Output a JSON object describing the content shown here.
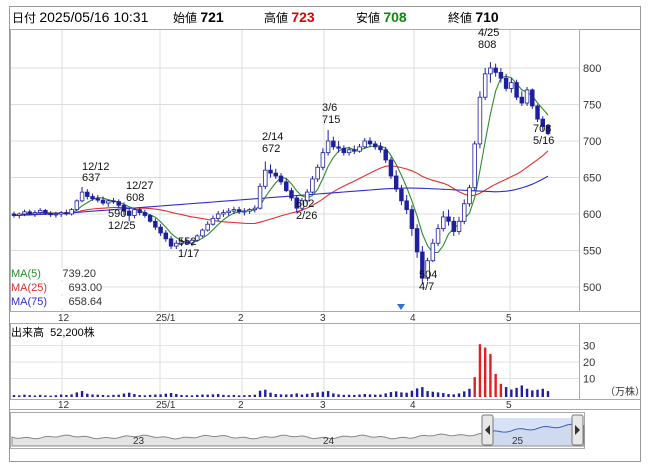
{
  "header": {
    "date_label": "日付",
    "datetime": "2025/05/16 10:31",
    "open_label": "始値",
    "open_value": "721",
    "high_label": "高値",
    "high_value": "723",
    "low_label": "安値",
    "low_value": "708",
    "close_label": "終値",
    "close_value": "710",
    "colors": {
      "high": "#e00000",
      "low": "#0a8a0a",
      "text": "#000000"
    }
  },
  "ma_legend": [
    {
      "label": "MA(5)",
      "value": "739.20",
      "color": "#2e8b2e"
    },
    {
      "label": "MA(25)",
      "value": "693.00",
      "color": "#e03030"
    },
    {
      "label": "MA(75)",
      "value": "658.64",
      "color": "#2f2fd0"
    }
  ],
  "volume": {
    "title": "出来高",
    "value": "52,200株",
    "unit": "（万株）",
    "axis_ticks": [
      "30",
      "20",
      "10"
    ]
  },
  "price_axis_ticks": [
    "800",
    "750",
    "700",
    "650",
    "600",
    "550",
    "500"
  ],
  "month_labels": [
    "12",
    "25/1",
    "2",
    "3",
    "4",
    "5"
  ],
  "navigator": {
    "year_labels": [
      "23",
      "24",
      "25"
    ],
    "left_handle_icon": "chevron-left-icon",
    "right_handle_icon": "chevron-right-icon"
  },
  "annotations": [
    {
      "top": "12/12",
      "bottom": "637"
    },
    {
      "top": "12/27",
      "bottom": "608"
    },
    {
      "top": "590",
      "bottom": "12/25"
    },
    {
      "top": "552",
      "bottom": "1/17"
    },
    {
      "top": "2/14",
      "bottom": "672"
    },
    {
      "top": "602",
      "bottom": "2/26"
    },
    {
      "top": "3/6",
      "bottom": "715"
    },
    {
      "top": "504",
      "bottom": "4/7"
    },
    {
      "top": "4/25",
      "bottom": "808"
    },
    {
      "top": "708",
      "bottom": "5/16"
    }
  ],
  "chart_data": {
    "type": "candlestick",
    "price_range": [
      480,
      830
    ],
    "volume_range": [
      0,
      40
    ],
    "up_color": "#1e1ea0",
    "down_color": "#1e1ea0",
    "series": [
      {
        "name": "MA(5)",
        "color": "#2e8b2e"
      },
      {
        "name": "MA(25)",
        "color": "#e03030"
      },
      {
        "name": "MA(75)",
        "color": "#2f2fd0"
      }
    ],
    "candles": [
      [
        600,
        603,
        595,
        598
      ],
      [
        598,
        602,
        594,
        600
      ],
      [
        600,
        606,
        597,
        603
      ],
      [
        603,
        606,
        598,
        600
      ],
      [
        600,
        605,
        596,
        602
      ],
      [
        602,
        608,
        600,
        605
      ],
      [
        605,
        607,
        599,
        601
      ],
      [
        601,
        604,
        596,
        599
      ],
      [
        599,
        603,
        595,
        600
      ],
      [
        600,
        604,
        596,
        602
      ],
      [
        602,
        606,
        598,
        600
      ],
      [
        600,
        608,
        598,
        606
      ],
      [
        606,
        620,
        604,
        618
      ],
      [
        618,
        637,
        616,
        630
      ],
      [
        630,
        634,
        620,
        624
      ],
      [
        624,
        628,
        618,
        621
      ],
      [
        621,
        626,
        616,
        619
      ],
      [
        619,
        624,
        612,
        615
      ],
      [
        615,
        620,
        610,
        618
      ],
      [
        618,
        622,
        614,
        617
      ],
      [
        617,
        620,
        608,
        612
      ],
      [
        612,
        616,
        598,
        604
      ],
      [
        604,
        608,
        590,
        598
      ],
      [
        598,
        608,
        594,
        606
      ],
      [
        606,
        608,
        598,
        602
      ],
      [
        602,
        606,
        595,
        598
      ],
      [
        598,
        600,
        588,
        590
      ],
      [
        590,
        594,
        578,
        582
      ],
      [
        582,
        586,
        570,
        574
      ],
      [
        574,
        578,
        562,
        566
      ],
      [
        566,
        570,
        552,
        556
      ],
      [
        556,
        564,
        552,
        560
      ],
      [
        560,
        566,
        556,
        562
      ],
      [
        562,
        566,
        558,
        560
      ],
      [
        560,
        566,
        556,
        564
      ],
      [
        564,
        572,
        562,
        570
      ],
      [
        570,
        580,
        568,
        578
      ],
      [
        578,
        590,
        576,
        586
      ],
      [
        586,
        598,
        584,
        594
      ],
      [
        594,
        604,
        590,
        600
      ],
      [
        600,
        606,
        596,
        602
      ],
      [
        602,
        608,
        598,
        604
      ],
      [
        604,
        610,
        600,
        606
      ],
      [
        606,
        610,
        600,
        603
      ],
      [
        603,
        608,
        598,
        604
      ],
      [
        604,
        608,
        600,
        606
      ],
      [
        606,
        612,
        602,
        608
      ],
      [
        608,
        642,
        606,
        638
      ],
      [
        638,
        672,
        634,
        660
      ],
      [
        660,
        668,
        650,
        656
      ],
      [
        656,
        662,
        648,
        652
      ],
      [
        652,
        656,
        640,
        644
      ],
      [
        644,
        648,
        630,
        632
      ],
      [
        632,
        636,
        618,
        622
      ],
      [
        622,
        626,
        602,
        608
      ],
      [
        608,
        622,
        604,
        618
      ],
      [
        618,
        634,
        614,
        630
      ],
      [
        630,
        652,
        628,
        648
      ],
      [
        648,
        668,
        644,
        664
      ],
      [
        664,
        690,
        660,
        684
      ],
      [
        684,
        715,
        680,
        700
      ],
      [
        700,
        706,
        688,
        692
      ],
      [
        692,
        700,
        684,
        690
      ],
      [
        690,
        694,
        680,
        684
      ],
      [
        684,
        692,
        680,
        688
      ],
      [
        688,
        694,
        682,
        686
      ],
      [
        686,
        696,
        684,
        692
      ],
      [
        692,
        704,
        690,
        700
      ],
      [
        700,
        705,
        692,
        696
      ],
      [
        696,
        700,
        688,
        692
      ],
      [
        692,
        698,
        684,
        688
      ],
      [
        688,
        692,
        670,
        674
      ],
      [
        674,
        678,
        648,
        652
      ],
      [
        652,
        660,
        630,
        634
      ],
      [
        634,
        640,
        612,
        618
      ],
      [
        618,
        626,
        600,
        606
      ],
      [
        606,
        612,
        570,
        580
      ],
      [
        580,
        586,
        540,
        548
      ],
      [
        548,
        556,
        504,
        512
      ],
      [
        512,
        540,
        508,
        536
      ],
      [
        536,
        566,
        534,
        560
      ],
      [
        560,
        586,
        556,
        580
      ],
      [
        580,
        604,
        576,
        596
      ],
      [
        596,
        606,
        584,
        590
      ],
      [
        590,
        596,
        570,
        576
      ],
      [
        576,
        596,
        572,
        590
      ],
      [
        590,
        620,
        586,
        614
      ],
      [
        614,
        640,
        610,
        636
      ],
      [
        636,
        700,
        632,
        696
      ],
      [
        696,
        768,
        690,
        760
      ],
      [
        760,
        800,
        756,
        792
      ],
      [
        792,
        808,
        780,
        800
      ],
      [
        800,
        806,
        788,
        794
      ],
      [
        794,
        800,
        780,
        786
      ],
      [
        786,
        792,
        768,
        772
      ],
      [
        772,
        786,
        766,
        780
      ],
      [
        780,
        784,
        756,
        760
      ],
      [
        760,
        768,
        748,
        752
      ],
      [
        752,
        774,
        748,
        770
      ],
      [
        770,
        772,
        744,
        748
      ],
      [
        748,
        750,
        726,
        730
      ],
      [
        730,
        734,
        714,
        720
      ],
      [
        721,
        723,
        708,
        710
      ]
    ],
    "volumes": [
      1.2,
      1.0,
      1.4,
      1.1,
      0.9,
      1.3,
      1.0,
      0.8,
      1.1,
      1.5,
      1.2,
      1.6,
      2.8,
      3.6,
      2.0,
      1.5,
      1.4,
      1.2,
      1.0,
      1.3,
      1.4,
      2.1,
      2.6,
      1.8,
      1.2,
      1.0,
      1.3,
      1.5,
      1.6,
      2.0,
      2.4,
      1.8,
      1.2,
      1.1,
      1.0,
      1.3,
      1.5,
      1.4,
      1.6,
      1.8,
      1.3,
      1.1,
      1.2,
      1.0,
      1.1,
      1.2,
      1.4,
      3.8,
      4.4,
      2.6,
      1.8,
      1.6,
      1.5,
      1.7,
      2.2,
      1.5,
      1.9,
      2.4,
      2.8,
      3.2,
      3.6,
      2.2,
      1.6,
      1.3,
      1.4,
      1.2,
      1.5,
      1.8,
      1.6,
      1.4,
      1.5,
      2.2,
      3.0,
      3.4,
      2.8,
      2.6,
      3.8,
      5.2,
      6.0,
      3.6,
      3.2,
      2.8,
      2.4,
      1.8,
      1.6,
      2.2,
      3.4,
      5.0,
      12.0,
      32.0,
      30.0,
      26.0,
      14.0,
      8.0,
      6.0,
      4.5,
      5.5,
      7.0,
      5.0,
      4.0,
      4.4,
      5.0,
      3.6
    ]
  }
}
